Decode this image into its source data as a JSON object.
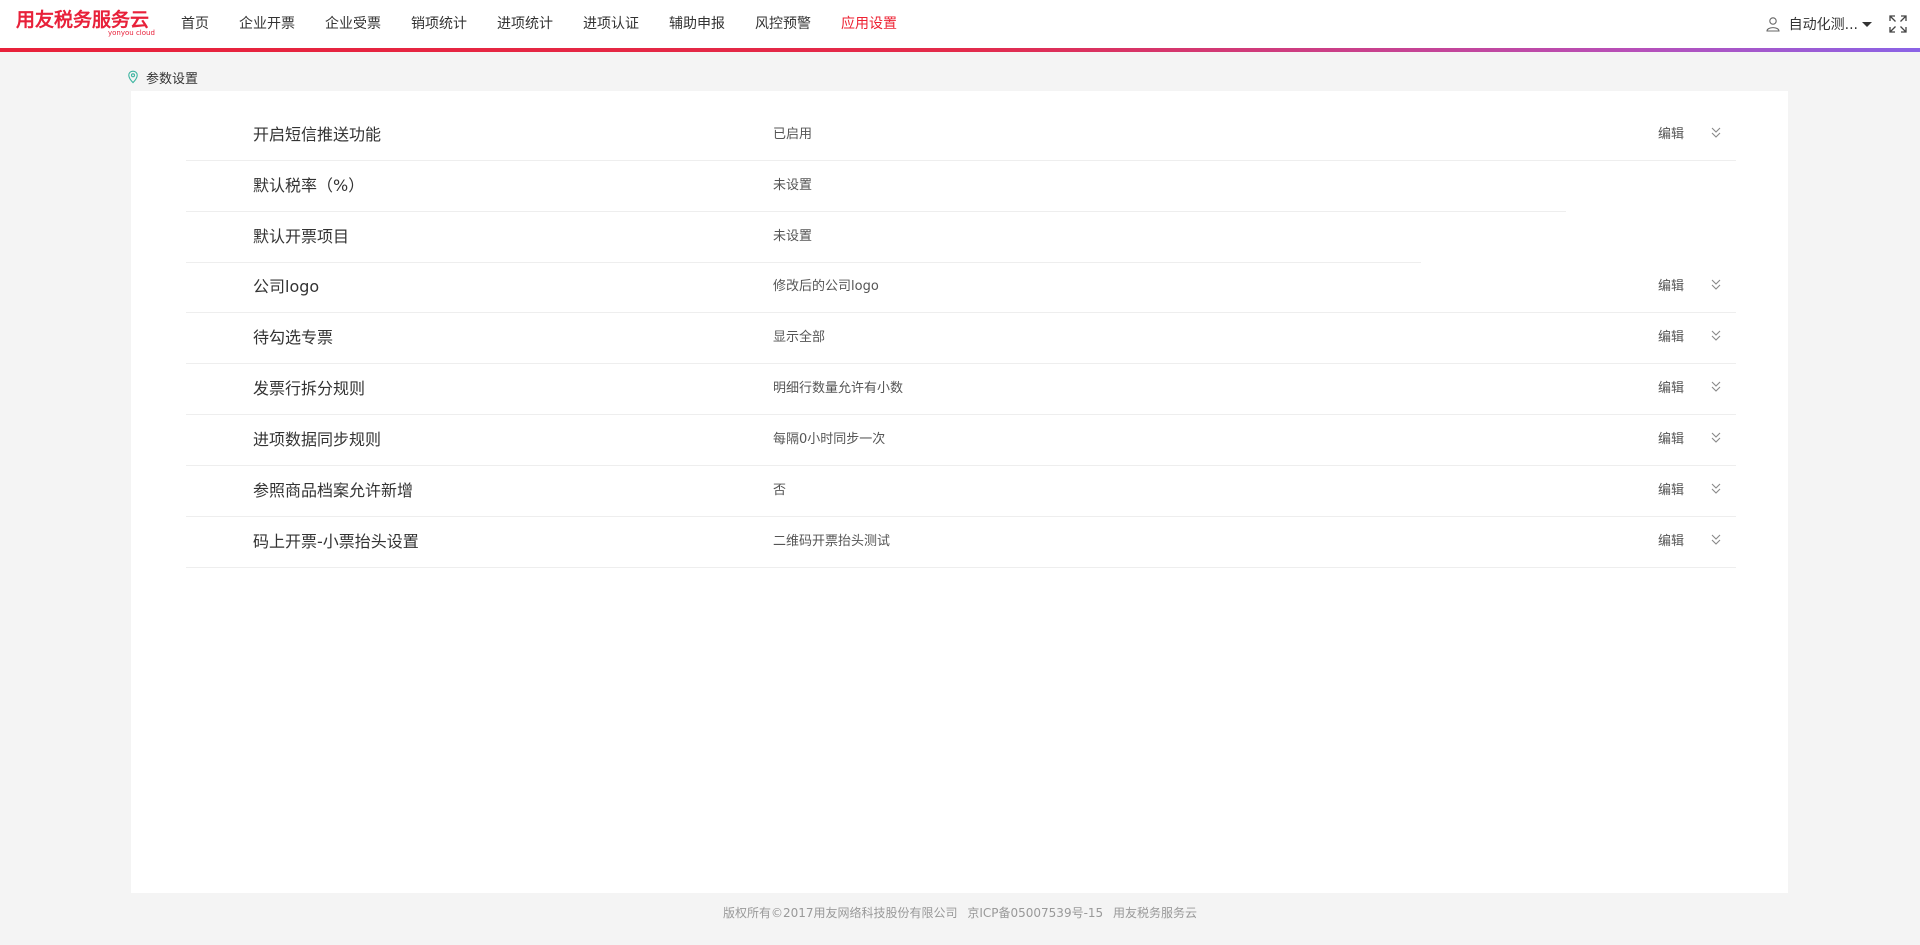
{
  "header": {
    "logo_text": "用友税务服务云",
    "logo_sub": "yonyou cloud",
    "nav": [
      {
        "label": "首页",
        "active": false
      },
      {
        "label": "企业开票",
        "active": false
      },
      {
        "label": "企业受票",
        "active": false
      },
      {
        "label": "销项统计",
        "active": false
      },
      {
        "label": "进项统计",
        "active": false
      },
      {
        "label": "进项认证",
        "active": false
      },
      {
        "label": "辅助申报",
        "active": false
      },
      {
        "label": "风控预警",
        "active": false
      },
      {
        "label": "应用设置",
        "active": true
      }
    ],
    "user_name": "自动化测..."
  },
  "breadcrumb": {
    "current": "参数设置"
  },
  "settings": {
    "rows": [
      {
        "label": "开启短信推送功能",
        "value": "已启用",
        "edit": "编辑",
        "has_edit": true
      },
      {
        "label": "默认税率（%）",
        "value": "未设置",
        "edit": "",
        "has_edit": false
      },
      {
        "label": "默认开票项目",
        "value": "未设置",
        "edit": "",
        "has_edit": false
      },
      {
        "label": "公司logo",
        "value": "修改后的公司logo",
        "edit": "编辑",
        "has_edit": true
      },
      {
        "label": "待勾选专票",
        "value": "显示全部",
        "edit": "编辑",
        "has_edit": true
      },
      {
        "label": "发票行拆分规则",
        "value": "明细行数量允许有小数",
        "edit": "编辑",
        "has_edit": true
      },
      {
        "label": "进项数据同步规则",
        "value": "每隔0小时同步一次",
        "edit": "编辑",
        "has_edit": true
      },
      {
        "label": "参照商品档案允许新增",
        "value": "否",
        "edit": "编辑",
        "has_edit": true
      },
      {
        "label": "码上开票-小票抬头设置",
        "value": "二维码开票抬头测试",
        "edit": "编辑",
        "has_edit": true
      }
    ]
  },
  "footer": {
    "copyright": "版权所有©2017用友网络科技股份有限公司",
    "icp": "京ICP备05007539号-15",
    "brand": "用友税务服务云"
  },
  "colors": {
    "accent": "#e8213a",
    "nav_active": "#ee2233",
    "gradient_end": "#8a63e6"
  }
}
